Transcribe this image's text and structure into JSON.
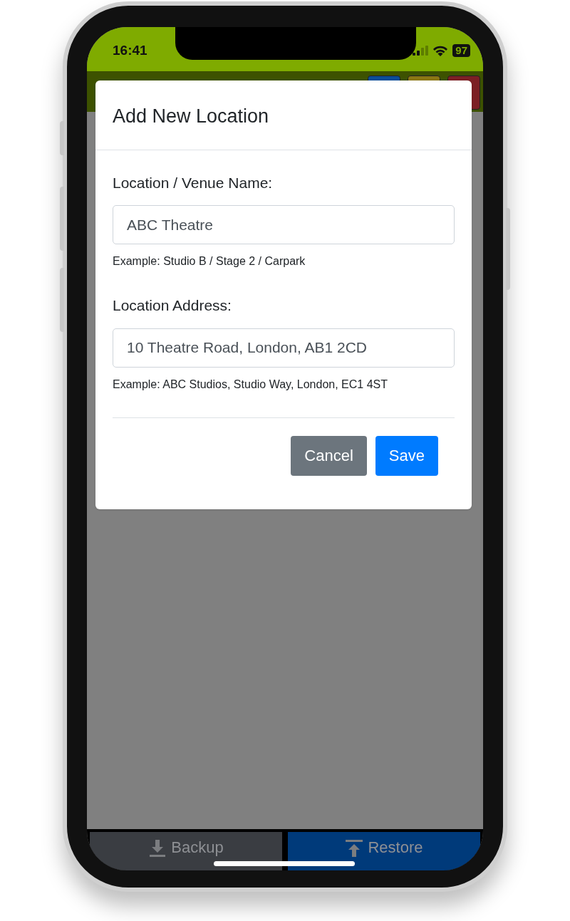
{
  "status_bar": {
    "time": "16:41",
    "battery": "97"
  },
  "header_buttons": [
    {
      "color": "#0a4c98"
    },
    {
      "color": "#8a7612"
    },
    {
      "color": "#7c1f24"
    }
  ],
  "modal": {
    "title": "Add New Location",
    "fields": [
      {
        "label": "Location / Venue Name:",
        "value": "ABC Theatre",
        "help": "Example: Studio B / Stage 2 / Carpark"
      },
      {
        "label": "Location Address:",
        "value": "10 Theatre Road, London, AB1 2CD",
        "help": "Example: ABC Studios, Studio Way, London, EC1 4ST"
      }
    ],
    "buttons": [
      {
        "label": "Cancel",
        "kind": "secondary"
      },
      {
        "label": "Save",
        "kind": "primary"
      }
    ]
  },
  "bottom_bar": [
    {
      "label": "Backup",
      "kind": "download"
    },
    {
      "label": "Restore",
      "kind": "upload"
    }
  ]
}
